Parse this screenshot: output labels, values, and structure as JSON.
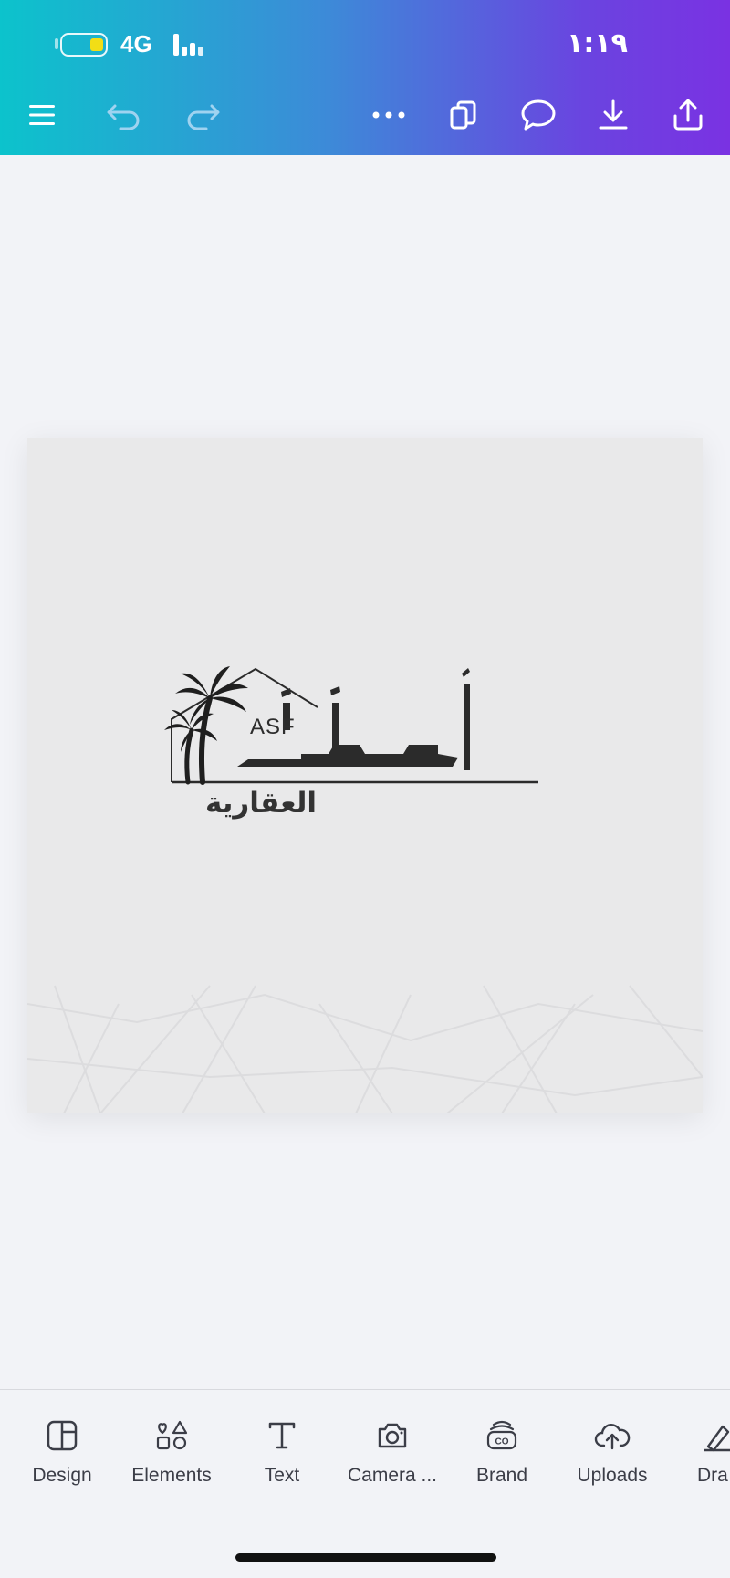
{
  "status_bar": {
    "network": "4G",
    "time": "١:١٩",
    "battery_level": 0.3
  },
  "toolbar": {
    "menu_icon": "menu-icon",
    "undo_icon": "undo-icon",
    "redo_icon": "redo-icon",
    "more_icon": "more-icon",
    "pages_icon": "pages-icon",
    "comment_icon": "comment-icon",
    "download_icon": "download-icon",
    "share_icon": "share-icon"
  },
  "design": {
    "logo_latin": "ASF",
    "logo_arabic_main": "أسف",
    "logo_arabic_sub": "العقارية"
  },
  "bottom_tabs": [
    {
      "label": "Design",
      "icon": "design-icon"
    },
    {
      "label": "Elements",
      "icon": "elements-icon"
    },
    {
      "label": "Text",
      "icon": "text-icon"
    },
    {
      "label": "Camera ...",
      "icon": "camera-icon"
    },
    {
      "label": "Brand",
      "icon": "brand-icon"
    },
    {
      "label": "Uploads",
      "icon": "uploads-icon"
    },
    {
      "label": "Dra",
      "icon": "draw-icon"
    }
  ],
  "colors": {
    "gradient_start": "#0cc3cc",
    "gradient_end": "#7a32e2",
    "canvas_bg": "#f2f3f7",
    "design_bg": "#e9e9ea",
    "logo_dark": "#2b2b2b",
    "battery_yellow": "#f2de16"
  }
}
